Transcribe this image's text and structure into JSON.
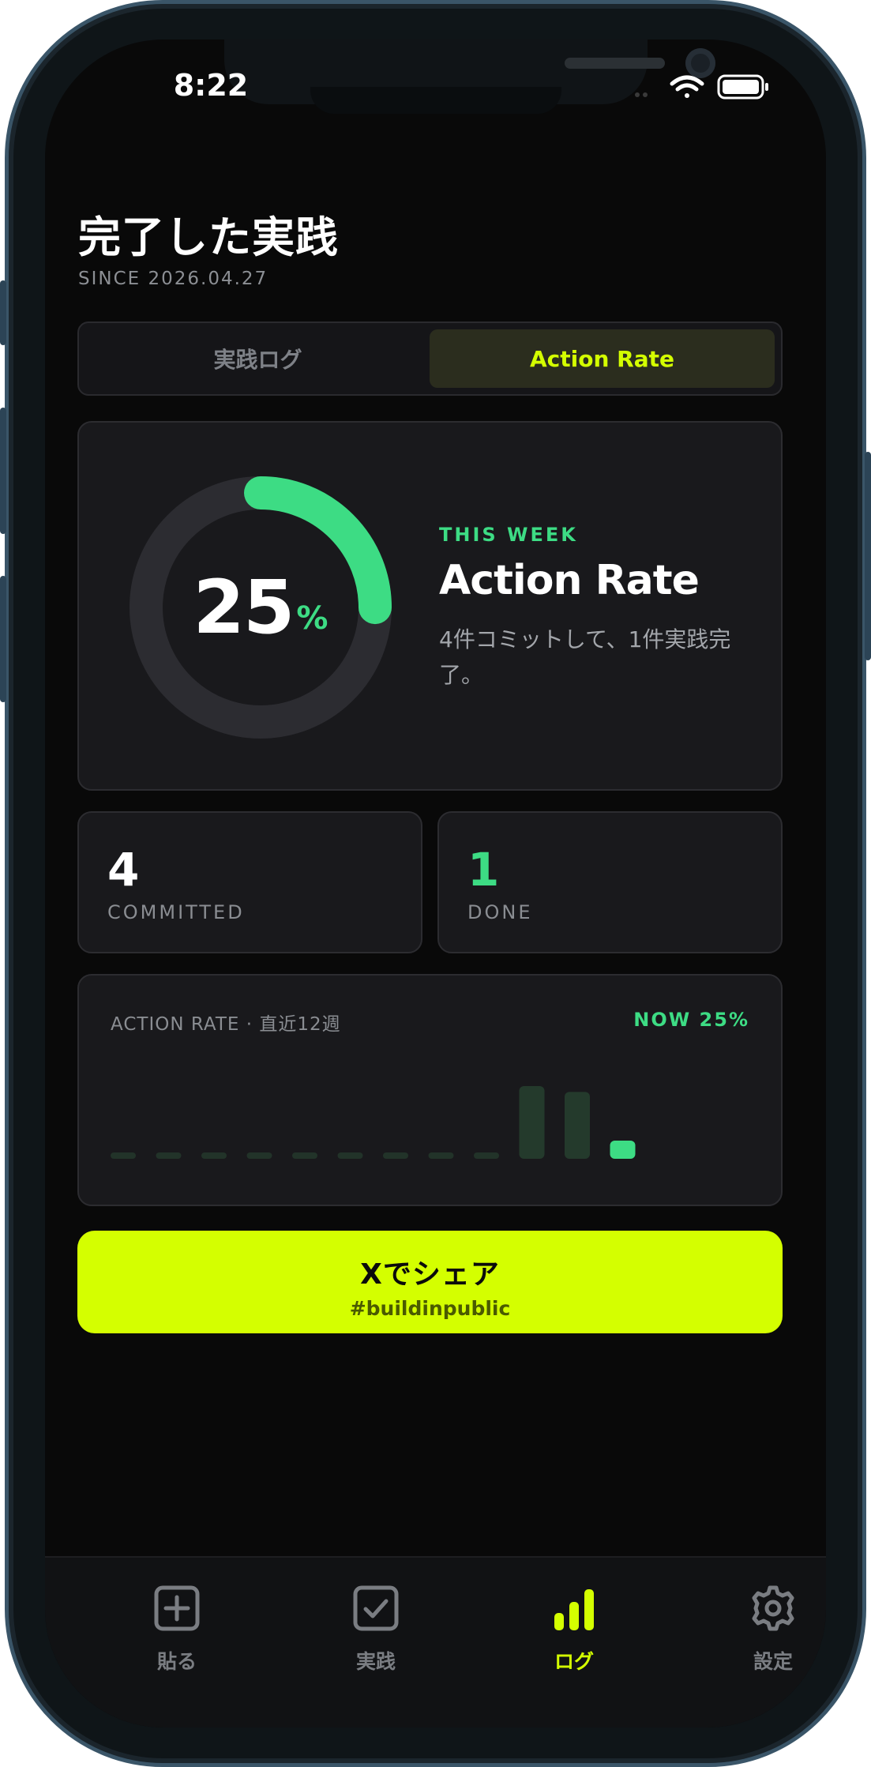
{
  "status_bar": {
    "time": "8:22"
  },
  "page": {
    "title": "完了した実践",
    "since": "SINCE 2026.04.27"
  },
  "segmented": {
    "tabs": [
      "実践ログ",
      "Action Rate"
    ],
    "active_index": 1
  },
  "rate_card": {
    "value": "25",
    "unit": "%",
    "percent": 25,
    "eyebrow": "THIS WEEK",
    "heading": "Action Rate",
    "description": "4件コミットして、1件実践完了。"
  },
  "stats": {
    "committed": {
      "value": "4",
      "label": "COMMITTED"
    },
    "done": {
      "value": "1",
      "label": "DONE"
    }
  },
  "chart": {
    "title": "ACTION RATE · 直近12週",
    "now_label": "NOW 25%"
  },
  "chart_data": {
    "type": "bar",
    "categories": [
      "",
      "",
      "",
      "",
      "",
      "",
      "",
      "",
      "",
      "",
      "",
      ""
    ],
    "values": [
      0,
      0,
      0,
      0,
      0,
      0,
      0,
      0,
      0,
      100,
      92,
      25
    ],
    "ylim": [
      0,
      100
    ],
    "highlight_index": 11
  },
  "share_button": {
    "label": "Xでシェア",
    "hashtag": "#buildinpublic"
  },
  "tab_bar": {
    "items": [
      {
        "label": "貼る",
        "icon": "plus-square-icon"
      },
      {
        "label": "実践",
        "icon": "check-square-icon"
      },
      {
        "label": "ログ",
        "icon": "bar-chart-icon"
      },
      {
        "label": "設定",
        "icon": "gear-icon"
      }
    ],
    "active_index": 2
  },
  "colors": {
    "accent_lime": "#d4ff00",
    "accent_green": "#3ddc84",
    "background": "#090909",
    "card": "#19191c"
  }
}
